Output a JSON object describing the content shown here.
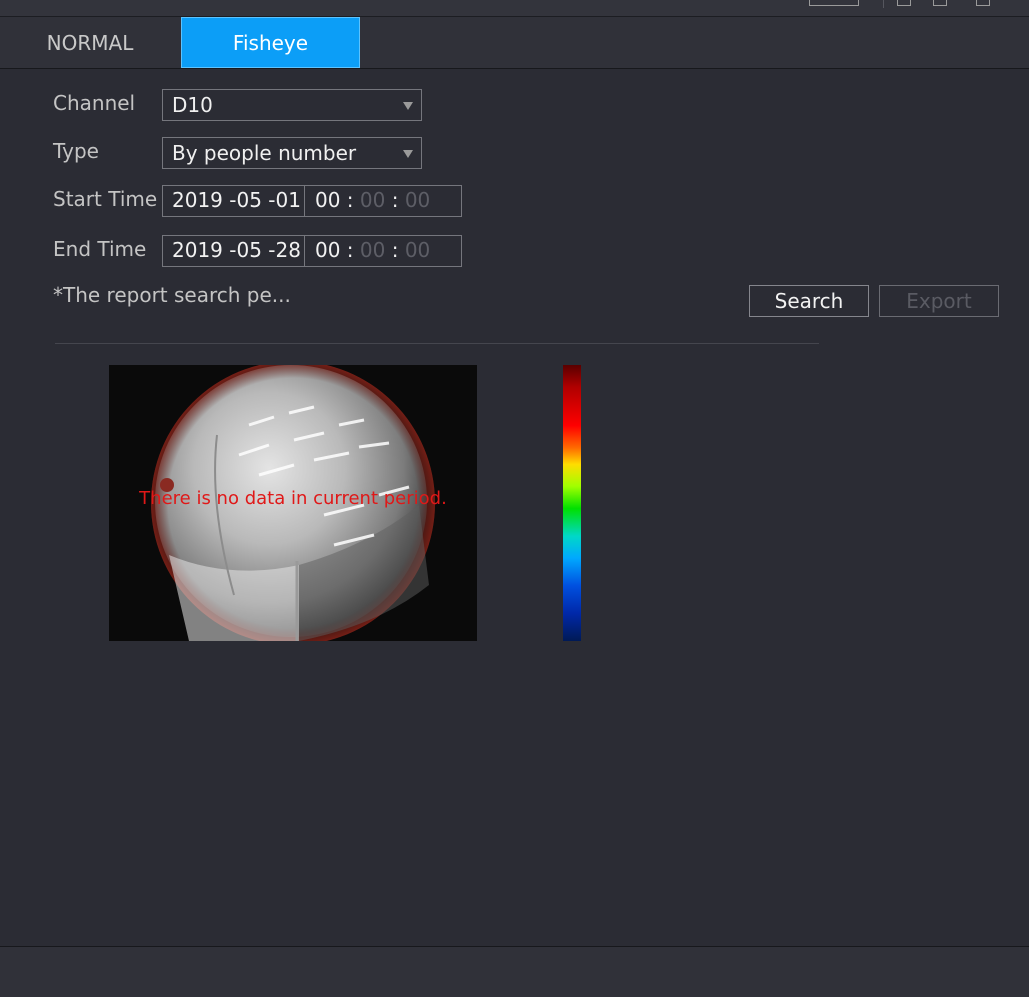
{
  "tabs": [
    {
      "label": "NORMAL",
      "active": false
    },
    {
      "label": "Fisheye",
      "active": true
    }
  ],
  "form": {
    "channel": {
      "label": "Channel",
      "value": "D10"
    },
    "type": {
      "label": "Type",
      "value": "By people number"
    },
    "start_time": {
      "label": "Start Time",
      "date": "2019 -05 -01",
      "hour": "00",
      "minute": "00",
      "second": "00"
    },
    "end_time": {
      "label": "End Time",
      "date": "2019 -05 -28",
      "hour": "00",
      "minute": "00",
      "second": "00"
    },
    "note": "*The report search pe..."
  },
  "buttons": {
    "search": "Search",
    "export": "Export"
  },
  "heatmap": {
    "message": "There is no data in current period."
  },
  "colors": {
    "accent": "#0c9ef7",
    "message": "#e01818",
    "background": "#2b2c34"
  }
}
